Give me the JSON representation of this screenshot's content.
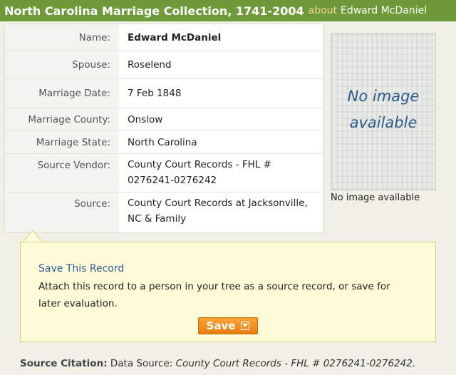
{
  "header": {
    "title": "North Carolina Marriage Collection, 1741-2004",
    "about": "about",
    "name": "Edward McDaniel"
  },
  "record": {
    "fields": [
      {
        "label": "Name:",
        "value": "Edward McDaniel"
      },
      {
        "label": "Spouse:",
        "value": "Roselend"
      },
      {
        "label": "Marriage Date:",
        "value": "7 Feb 1848"
      },
      {
        "label": "Marriage County:",
        "value": "Onslow"
      },
      {
        "label": "Marriage State:",
        "value": "North Carolina"
      },
      {
        "label": "Source Vendor:",
        "value": "County Court Records - FHL # 0276241-0276242"
      },
      {
        "label": "Source:",
        "value": "County Court Records at Jacksonville, NC & Family"
      }
    ]
  },
  "image": {
    "placeholder_line1": "No image",
    "placeholder_line2": "available",
    "caption": "No image available"
  },
  "save_panel": {
    "title": "Save This Record",
    "description": "Attach this record to a person in your tree as a source record, or save for later evaluation.",
    "button_label": "Save",
    "icon": "chevron-down-icon"
  },
  "citation": {
    "label": "Source Citation:",
    "prefix": "Data Source:",
    "value": "County Court Records - FHL # 0276241-0276242."
  },
  "colors": {
    "header_bg": "#6f9a39",
    "about_text": "#f4d28a",
    "link": "#2b5c96",
    "button": "#ea7d0e",
    "panel_bg": "#fdfbd8"
  }
}
